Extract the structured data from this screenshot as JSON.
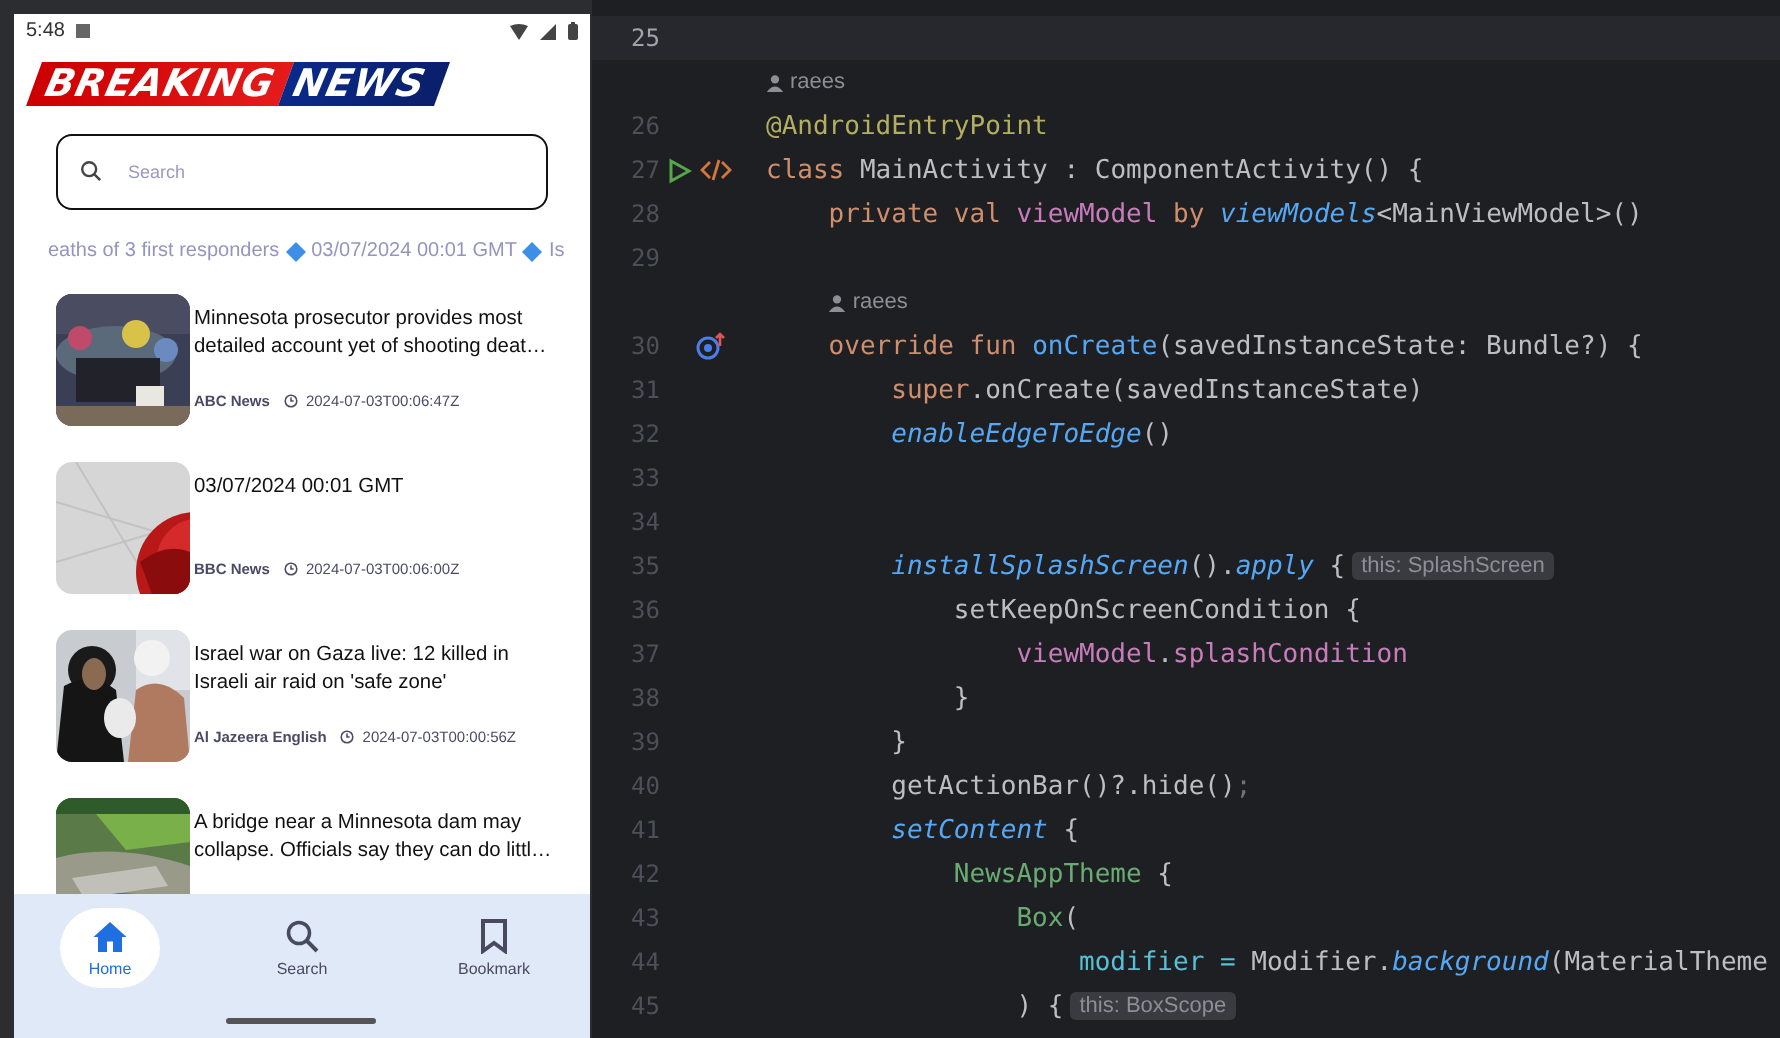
{
  "phone": {
    "status_bar": {
      "time": "5:48"
    },
    "logo": {
      "first": "BREAKING",
      "second": "NEWS"
    },
    "search": {
      "placeholder": "Search"
    },
    "ticker": [
      "eaths of 3 first responders",
      "03/07/2024 00:01 GMT",
      "Is"
    ],
    "articles": [
      {
        "title": "Minnesota prosecutor provides most detailed account yet of shooting deat…",
        "source": "ABC News",
        "time": "2024-07-03T00:06:47Z",
        "kind": "memorial"
      },
      {
        "title": "03/07/2024 00:01 GMT",
        "source": "BBC News",
        "time": "2024-07-03T00:06:00Z",
        "kind": "globe"
      },
      {
        "title": "Israel war on Gaza live: 12 killed in Israeli air raid on 'safe zone'",
        "source": "Al Jazeera English",
        "time": "2024-07-03T00:00:56Z",
        "kind": "people"
      },
      {
        "title": "A bridge near a Minnesota dam may collapse. Officials say they can do littl…",
        "kind": "river"
      }
    ],
    "nav": [
      {
        "label": "Home",
        "selected": true
      },
      {
        "label": "Search",
        "selected": false
      },
      {
        "label": "Bookmark",
        "selected": false
      }
    ]
  },
  "editor": {
    "lines": [
      {
        "number": "25",
        "current": true
      },
      {
        "number": "26",
        "author": "raees",
        "tokens": [
          {
            "t": "@AndroidEntryPoint",
            "kind": "annotation"
          }
        ]
      },
      {
        "number": "27",
        "gutter": {
          "kind": "run"
        },
        "tokens": [
          {
            "t": "class ",
            "kind": "keyword"
          },
          {
            "t": "MainActivity : ComponentActivity() {",
            "kind": "plain"
          }
        ]
      },
      {
        "number": "28",
        "tokens": [
          {
            "t": "    private val ",
            "kind": "keyword"
          },
          {
            "t": "viewModel",
            "kind": "property"
          },
          {
            "t": " by ",
            "kind": "keyword"
          },
          {
            "t": "viewModels",
            "kind": "call"
          },
          {
            "t": "<MainViewModel>()",
            "kind": "plain"
          }
        ]
      },
      {
        "number": "29"
      },
      {
        "number": "30",
        "author": "raees",
        "gutter": {
          "kind": "override"
        },
        "tokens": [
          {
            "t": "    override fun ",
            "kind": "keyword"
          },
          {
            "t": "onCreate",
            "kind": "declaration"
          },
          {
            "t": "(savedInstanceState: Bundle?) {",
            "kind": "plain"
          }
        ]
      },
      {
        "number": "31",
        "tokens": [
          {
            "t": "        super",
            "kind": "keyword"
          },
          {
            "t": ".onCreate(savedInstanceState)",
            "kind": "plain"
          }
        ]
      },
      {
        "number": "32",
        "tokens": [
          {
            "t": "        enableEdgeToEdge",
            "kind": "call"
          },
          {
            "t": "()",
            "kind": "plain"
          }
        ]
      },
      {
        "number": "33"
      },
      {
        "number": "34"
      },
      {
        "number": "35",
        "hint": "this: SplashScreen",
        "tokens": [
          {
            "t": "        installSplashScreen",
            "kind": "call"
          },
          {
            "t": "().",
            "kind": "plain"
          },
          {
            "t": "apply",
            "kind": "call"
          },
          {
            "t": " {",
            "kind": "plain"
          }
        ]
      },
      {
        "number": "36",
        "tokens": [
          {
            "t": "            setKeepOnScreenCondition {",
            "kind": "plain"
          }
        ]
      },
      {
        "number": "37",
        "tokens": [
          {
            "t": "                viewModel",
            "kind": "property"
          },
          {
            "t": ".",
            "kind": "plain"
          },
          {
            "t": "splashCondition",
            "kind": "property"
          }
        ]
      },
      {
        "number": "38",
        "tokens": [
          {
            "t": "            }",
            "kind": "plain"
          }
        ]
      },
      {
        "number": "39",
        "tokens": [
          {
            "t": "        }",
            "kind": "plain"
          }
        ]
      },
      {
        "number": "40",
        "tokens": [
          {
            "t": "        getActionBar()?.hide()",
            "kind": "plain"
          },
          {
            "t": ";",
            "kind": "unused"
          }
        ]
      },
      {
        "number": "41",
        "tokens": [
          {
            "t": "        setContent",
            "kind": "call"
          },
          {
            "t": " {",
            "kind": "plain"
          }
        ]
      },
      {
        "number": "42",
        "tokens": [
          {
            "t": "            NewsAppTheme",
            "kind": "composable"
          },
          {
            "t": " {",
            "kind": "plain"
          }
        ]
      },
      {
        "number": "43",
        "tokens": [
          {
            "t": "                Box",
            "kind": "composable"
          },
          {
            "t": "(",
            "kind": "plain"
          }
        ]
      },
      {
        "number": "44",
        "tokens": [
          {
            "t": "                    modifier = ",
            "kind": "named_argument"
          },
          {
            "t": "Modifier.",
            "kind": "plain"
          },
          {
            "t": "background",
            "kind": "call"
          },
          {
            "t": "(MaterialTheme",
            "kind": "plain"
          }
        ]
      },
      {
        "number": "45",
        "hint": "this: BoxScope",
        "tokens": [
          {
            "t": "                ) {",
            "kind": "plain"
          }
        ]
      }
    ]
  }
}
